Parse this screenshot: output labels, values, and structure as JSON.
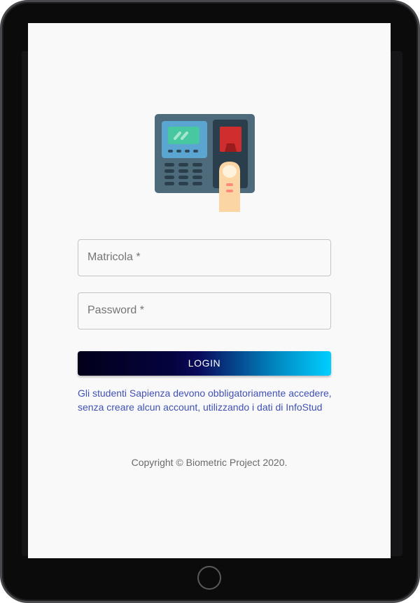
{
  "logo": {
    "icon": "fingerprint-attendance-scanner-icon"
  },
  "form": {
    "matricola_label": "Matricola *",
    "password_label": "Password *",
    "login_label": "LOGIN"
  },
  "notice": {
    "line1": "Gli studenti Sapienza devono obbligatoriamente accedere,",
    "line2": "senza creare alcun account, utilizzando i dati di InfoStud"
  },
  "footer": {
    "copyright": "Copyright © Biometric Project 2020."
  },
  "colors": {
    "background": "#f9f9f9",
    "link": "#3f51b5",
    "button_gradient_start": "#02001a",
    "button_gradient_end": "#00cfff",
    "device_frame": "#0b0b0c"
  }
}
